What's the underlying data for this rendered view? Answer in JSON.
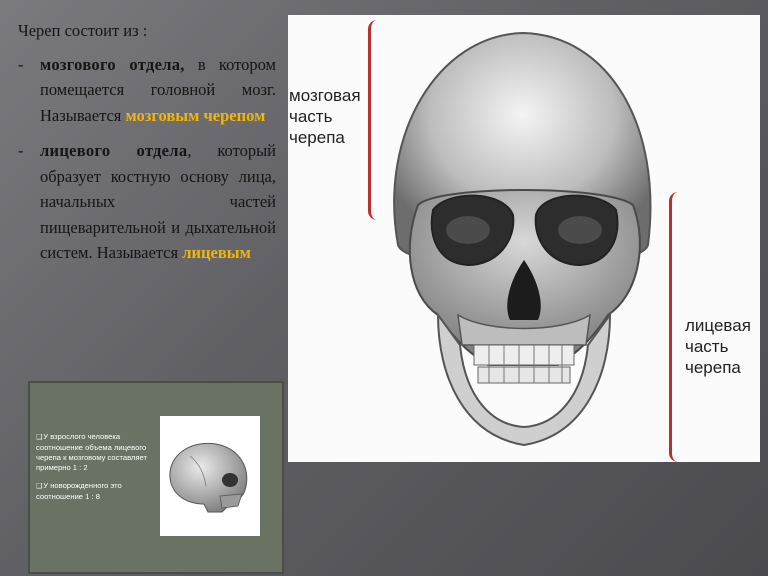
{
  "text": {
    "intro": "Череп состоит из :",
    "dash": "-",
    "item1": {
      "term": "мозгового отдела,",
      "body": " в котором помещается головной мозг. Называется ",
      "highlight": "мозговым черепом"
    },
    "item2": {
      "term": "лицевого отдела",
      "body": ", который образует костную основу лица, начальных частей пищеварительной и дыхательной систем. Называется ",
      "highlight": "лицевым"
    }
  },
  "photo": {
    "label_brain": "мозговая\nчасть\nчерепа",
    "label_face": "лицевая\nчасть\nчерепа"
  },
  "inset": {
    "bullet": "❑",
    "p1": "У взрослого человека соотношение объема лицевого черепа к мозговому составляет примерно 1 : 2",
    "p2": "У новорожденного это соотношение 1 : 8"
  },
  "colors": {
    "highlight": "#f2b705",
    "bracket": "#b73131",
    "inset_bg": "#6a7263"
  }
}
